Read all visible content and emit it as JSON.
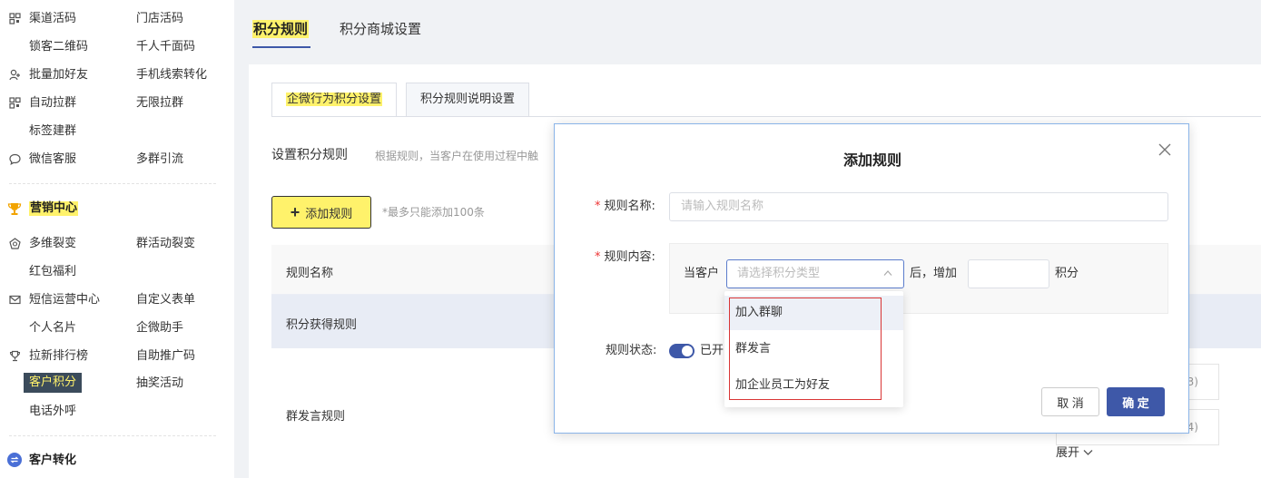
{
  "sidebar": {
    "groups": [
      {
        "left": "渠道活码",
        "right": "门店活码",
        "icon": "qrcode-icon"
      },
      {
        "left": "锁客二维码",
        "right": "千人千面码",
        "icon": ""
      },
      {
        "left": "批量加好友",
        "right": "手机线索转化",
        "icon": "add-friend-icon"
      },
      {
        "left": "自动拉群",
        "right": "无限拉群",
        "icon": "qrcode-icon"
      },
      {
        "left": "标签建群",
        "right": "",
        "icon": ""
      },
      {
        "left": "微信客服",
        "right": "多群引流",
        "icon": "chat-icon"
      }
    ],
    "marketing_title": "营销中心",
    "marketing": [
      {
        "left": "多维裂变",
        "right": "群活动裂变",
        "icon": "fission-icon"
      },
      {
        "left": "红包福利",
        "right": "",
        "icon": ""
      },
      {
        "left": "短信运营中心",
        "right": "自定义表单",
        "icon": "mail-icon"
      },
      {
        "left": "个人名片",
        "right": "企微助手",
        "icon": ""
      },
      {
        "left": "拉新排行榜",
        "right": "自助推广码",
        "icon": "trophy-icon"
      },
      {
        "left": "客户积分",
        "right": "抽奖活动",
        "icon": ""
      },
      {
        "left": "电话外呼",
        "right": "",
        "icon": ""
      }
    ],
    "conversion_title": "客户转化",
    "colors": {
      "active_bg": "#3b4b5b",
      "highlight": "#fff26b",
      "trophy": "#f2a400",
      "badge": "#4a6fd6"
    }
  },
  "top_tabs": [
    "积分规则",
    "积分商城设置"
  ],
  "sub_tabs": [
    "企微行为积分设置",
    "积分规则说明设置"
  ],
  "section": {
    "title": "设置积分规则",
    "desc": "根据规则，当客户在使用过程中触",
    "add_button": "添加规则",
    "add_tip": "*最多只能添加100条"
  },
  "table": {
    "header": "规则名称",
    "rows": [
      "积分获得规则",
      "群发言规则"
    ],
    "sub_nums": [
      "3)",
      "4)"
    ],
    "expand": "展开"
  },
  "modal": {
    "title": "添加规则",
    "name_label": "规则名称:",
    "name_placeholder": "请输入规则名称",
    "content_label": "规则内容:",
    "prefix": "当客户",
    "select_placeholder": "请选择积分类型",
    "after": "后，增加",
    "unit": "积分",
    "status_label": "规则状态:",
    "status_value": "已开",
    "cancel": "取 消",
    "ok": "确 定"
  },
  "dropdown": {
    "options": [
      "加入群聊",
      "群发言",
      "加企业员工为好友"
    ]
  },
  "colors": {
    "primary": "#3e58a8",
    "highlight": "#fff26b",
    "required": "#e33333",
    "outline": "#d93535"
  }
}
